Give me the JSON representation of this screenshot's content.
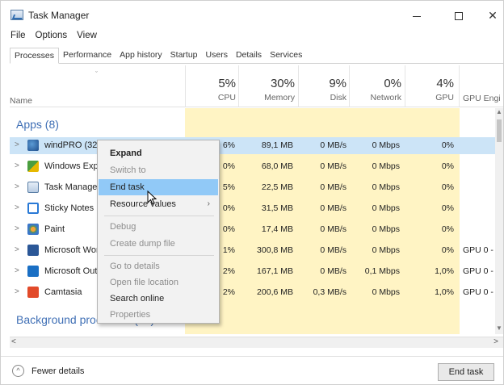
{
  "window": {
    "title": "Task Manager",
    "controls": {
      "minimize": "–",
      "maximize": "□",
      "close": "✕"
    }
  },
  "menu": [
    "File",
    "Options",
    "View"
  ],
  "tabs": [
    "Processes",
    "Performance",
    "App history",
    "Startup",
    "Users",
    "Details",
    "Services"
  ],
  "active_tab": "Processes",
  "header": {
    "name": "Name",
    "sort_indicator": "ˇ",
    "cpu": {
      "pct": "5%",
      "label": "CPU"
    },
    "memory": {
      "pct": "30%",
      "label": "Memory"
    },
    "disk": {
      "pct": "9%",
      "label": "Disk"
    },
    "network": {
      "pct": "0%",
      "label": "Network"
    },
    "gpu": {
      "pct": "4%",
      "label": "GPU"
    },
    "gpu_engine": {
      "label": "GPU Engi"
    }
  },
  "groups": {
    "apps": "Apps (8)",
    "background": "Background processes (63)"
  },
  "rows": [
    {
      "expander": ">",
      "icon": "wind-icon",
      "name": "windPRO (32 bit)",
      "cpu": "6%",
      "memory": "89,1 MB",
      "disk": "0 MB/s",
      "network": "0 Mbps",
      "gpu": "0%",
      "gpu_engine": "",
      "selected": true
    },
    {
      "expander": ">",
      "icon": "windows-icon",
      "name": "Windows Explorer",
      "cpu": "0%",
      "memory": "68,0 MB",
      "disk": "0 MB/s",
      "network": "0 Mbps",
      "gpu": "0%",
      "gpu_engine": ""
    },
    {
      "expander": ">",
      "icon": "task-manager-icon",
      "name": "Task Manager",
      "cpu": "5%",
      "memory": "22,5 MB",
      "disk": "0 MB/s",
      "network": "0 Mbps",
      "gpu": "0%",
      "gpu_engine": ""
    },
    {
      "expander": ">",
      "icon": "sticky-notes-icon",
      "name": "Sticky Notes",
      "cpu": "0%",
      "memory": "31,5 MB",
      "disk": "0 MB/s",
      "network": "0 Mbps",
      "gpu": "0%",
      "gpu_engine": ""
    },
    {
      "expander": ">",
      "icon": "paint-icon",
      "name": "Paint",
      "cpu": "0%",
      "memory": "17,4 MB",
      "disk": "0 MB/s",
      "network": "0 Mbps",
      "gpu": "0%",
      "gpu_engine": ""
    },
    {
      "expander": ">",
      "icon": "word-icon",
      "name": "Microsoft Word",
      "cpu": "1%",
      "memory": "300,8 MB",
      "disk": "0 MB/s",
      "network": "0 Mbps",
      "gpu": "0%",
      "gpu_engine": "GPU 0 -"
    },
    {
      "expander": ">",
      "icon": "outlook-icon",
      "name": "Microsoft Outlook",
      "cpu": "2%",
      "memory": "167,1 MB",
      "disk": "0 MB/s",
      "network": "0,1 Mbps",
      "gpu": "1,0%",
      "gpu_engine": "GPU 0 -"
    },
    {
      "expander": ">",
      "icon": "camtasia-icon",
      "name": "Camtasia",
      "cpu": "2%",
      "memory": "200,6 MB",
      "disk": "0,3 MB/s",
      "network": "0 Mbps",
      "gpu": "1,0%",
      "gpu_engine": "GPU 0 -"
    }
  ],
  "context_menu": [
    {
      "label": "Expand",
      "bold": true,
      "disabled": false
    },
    {
      "label": "Switch to",
      "bold": false,
      "disabled": true
    },
    {
      "label": "End task",
      "bold": false,
      "disabled": false,
      "hover": true
    },
    {
      "label": "Resource values",
      "bold": false,
      "disabled": false,
      "submenu": true
    },
    {
      "separator": true
    },
    {
      "label": "Debug",
      "bold": false,
      "disabled": true
    },
    {
      "label": "Create dump file",
      "bold": false,
      "disabled": true
    },
    {
      "separator": true
    },
    {
      "label": "Go to details",
      "bold": false,
      "disabled": true
    },
    {
      "label": "Open file location",
      "bold": false,
      "disabled": true
    },
    {
      "label": "Search online",
      "bold": false,
      "disabled": false
    },
    {
      "label": "Properties",
      "bold": false,
      "disabled": true
    }
  ],
  "footer": {
    "fewer_details": "Fewer details",
    "fewer_icon": "^",
    "end_task": "End task"
  },
  "scroll": {
    "up": "▲",
    "down": "▼",
    "left": "<",
    "right": ">"
  },
  "colors": {
    "selected_row": "#cce4f7",
    "heat_light": "#fff4c4",
    "group_title": "#3f6fb5",
    "menu_hover": "#91c9f7"
  }
}
